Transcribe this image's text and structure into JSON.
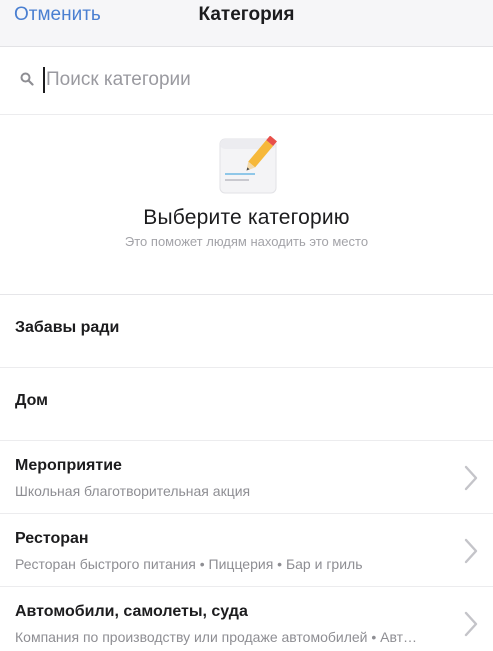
{
  "navbar": {
    "cancel_label": "Отменить",
    "title": "Категория",
    "accent_color": "#4a7fd1"
  },
  "search": {
    "icon": "search-icon",
    "placeholder": "Поиск категории",
    "value": ""
  },
  "hero": {
    "icon": "pencil-paper-icon",
    "title": "Выберите категорию",
    "subtitle": "Это поможет людям находить это место"
  },
  "categories": [
    {
      "title": "Забавы ради",
      "subtitle": "",
      "has_chevron": false
    },
    {
      "title": "Дом",
      "subtitle": "",
      "has_chevron": false
    },
    {
      "title": "Мероприятие",
      "subtitle": "Школьная благотворительная акция",
      "has_chevron": true
    },
    {
      "title": "Ресторан",
      "subtitle": "Ресторан быстрого питания • Пиццерия • Бар и гриль",
      "has_chevron": true
    },
    {
      "title": "Автомобили, самолеты, суда",
      "subtitle": "Компания по производству или продаже автомобилей • Авт…",
      "has_chevron": true
    }
  ]
}
